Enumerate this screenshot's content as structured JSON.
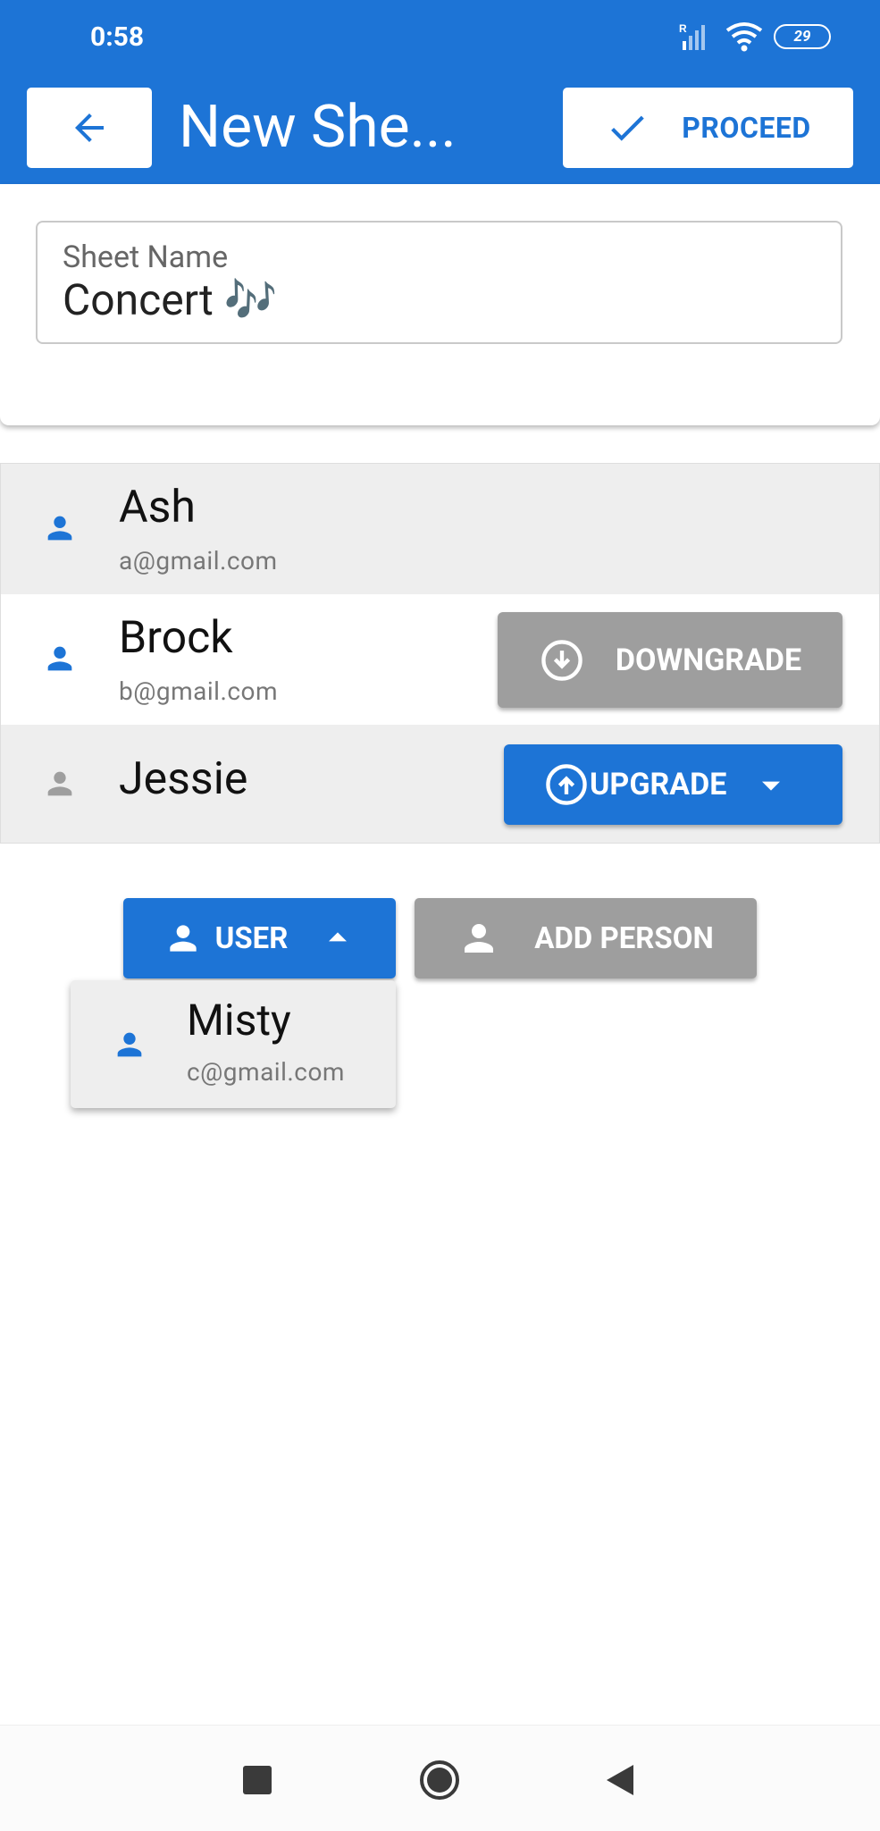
{
  "status_bar": {
    "time": "0:58",
    "battery": "29"
  },
  "app_bar": {
    "title": "New She...",
    "proceed_label": "PROCEED"
  },
  "sheet_name": {
    "label": "Sheet Name",
    "value": "Concert 🎶"
  },
  "people": [
    {
      "name": "Ash",
      "email": "a@gmail.com"
    },
    {
      "name": "Brock",
      "email": "b@gmail.com",
      "action": "DOWNGRADE"
    },
    {
      "name": "Jessie",
      "action": "UPGRADE"
    }
  ],
  "user_dropdown": {
    "label": "USER",
    "options": [
      {
        "name": "Misty",
        "email": "c@gmail.com"
      }
    ]
  },
  "add_person_label": "ADD PERSON",
  "colors": {
    "primary": "#1d74d6",
    "grey_button": "#9e9e9e",
    "row_grey": "#eeeeee"
  },
  "icons": [
    "arrow-back-icon",
    "check-icon",
    "person-icon",
    "arrow-circle-down-icon",
    "arrow-circle-up-icon",
    "arrow-drop-down-icon",
    "arrow-drop-up-icon"
  ]
}
